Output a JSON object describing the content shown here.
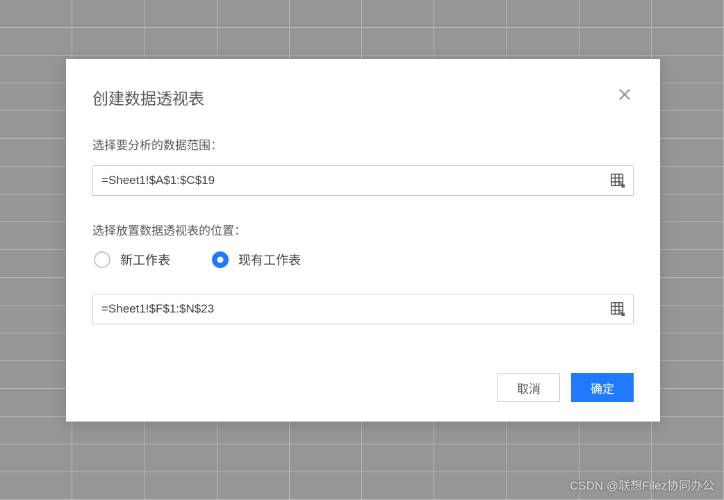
{
  "modal": {
    "title": "创建数据透视表",
    "dataRange": {
      "label": "选择要分析的数据范围：",
      "value": "=Sheet1!$A$1:$C$19"
    },
    "placement": {
      "label": "选择放置数据透视表的位置：",
      "options": {
        "newSheet": "新工作表",
        "existingSheet": "现有工作表"
      },
      "selected": "existingSheet",
      "targetRange": "=Sheet1!$F$1:$N$23"
    },
    "buttons": {
      "cancel": "取消",
      "confirm": "确定"
    }
  },
  "watermark": "CSDN @联想Filez协同办公"
}
